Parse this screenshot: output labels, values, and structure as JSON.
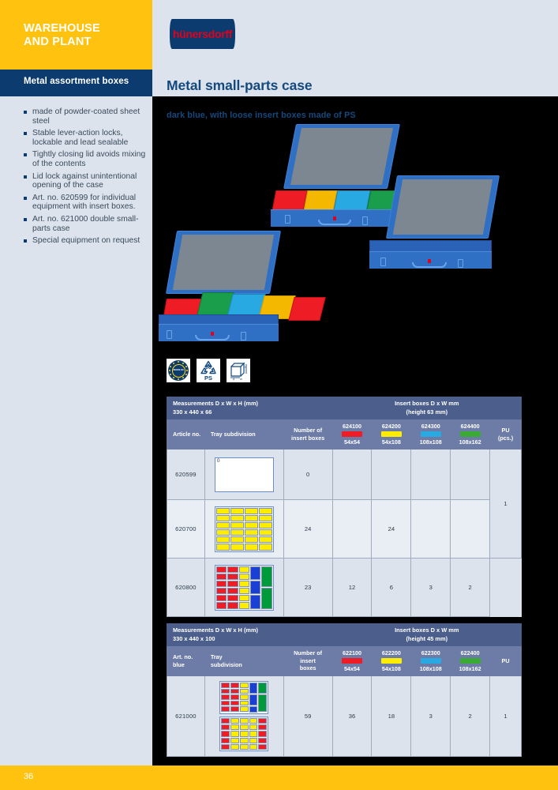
{
  "sidebar": {
    "category": "WAREHOUSE\nAND PLANT",
    "subcategory": "Metal assortment boxes",
    "features": [
      "made of powder-coated sheet steel",
      "Stable lever-action locks, lockable and lead sealable",
      "Tightly closing lid avoids mixing of the contents",
      "Lid lock against unintentional opening of the case",
      "Art. no. 620599 for individual equipment with insert boxes.",
      "Art. no. 621000 double small-parts case",
      "Special equipment on request"
    ]
  },
  "brand": {
    "logo_text": "hünersdorff"
  },
  "header": {
    "title": "Metal small-parts case",
    "subtitle": "dark blue, with loose insert boxes made of PS"
  },
  "certifications": [
    {
      "name": "made-in-europe",
      "line1": "MADE IN",
      "line2": "EUROPE"
    },
    {
      "name": "recycling-ps",
      "number": "06",
      "material": "PS"
    },
    {
      "name": "dimensions-cube",
      "d": "d",
      "w": "w",
      "h": "h"
    }
  ],
  "footer": {
    "page_number": "36"
  },
  "chart_data": {
    "type": "table",
    "title": "Metal small-parts case specifications",
    "tables": [
      {
        "id": "table-66",
        "measurements_label": "Measurements D x W x H (mm)",
        "measurements_value": "330 x 440 x 66",
        "insert_label": "Insert boxes D x W mm",
        "insert_height": "(height 63 mm)",
        "columns": [
          {
            "key": "art",
            "label": "Article\nno."
          },
          {
            "key": "tray",
            "label": "Tray subdivision"
          },
          {
            "key": "count",
            "label": "Number of\ninsert boxes"
          },
          {
            "key": "c1",
            "label": "624100",
            "size": "54x54",
            "color": "#ee1c25"
          },
          {
            "key": "c2",
            "label": "624200",
            "size": "54x108",
            "color": "#ffed00"
          },
          {
            "key": "c3",
            "label": "624300",
            "size": "108x108",
            "color": "#29a9e1"
          },
          {
            "key": "c4",
            "label": "624400",
            "size": "108x162",
            "color": "#3aaa35"
          },
          {
            "key": "pu",
            "label": "PU\n(pcs.)"
          }
        ],
        "rows": [
          {
            "art": "620599",
            "count": "0",
            "c1": "",
            "c2": "",
            "c3": "",
            "c4": "",
            "pu": ""
          },
          {
            "art": "620700",
            "count": "24",
            "c1": "",
            "c2": "24",
            "c3": "",
            "c4": "",
            "pu": "1"
          },
          {
            "art": "620800",
            "count": "23",
            "c1": "12",
            "c2": "6",
            "c3": "3",
            "c4": "2",
            "pu": ""
          }
        ]
      },
      {
        "id": "table-100",
        "measurements_label": "Measurements D x W x H (mm)",
        "measurements_value": "330 x 440 x 100",
        "insert_label": "Insert boxes D x W mm",
        "insert_height": "(height 45 mm)",
        "columns": [
          {
            "key": "art",
            "label": "Art. no.\nblue"
          },
          {
            "key": "tray",
            "label": "Tray\nsubdivision"
          },
          {
            "key": "count",
            "label": "Number of\ninsert\nboxes"
          },
          {
            "key": "c1",
            "label": "622100",
            "size": "54x54",
            "color": "#ee1c25"
          },
          {
            "key": "c2",
            "label": "622200",
            "size": "54x108",
            "color": "#ffed00"
          },
          {
            "key": "c3",
            "label": "622300",
            "size": "108x108",
            "color": "#29a9e1"
          },
          {
            "key": "c4",
            "label": "622400",
            "size": "108x162",
            "color": "#3aaa35"
          },
          {
            "key": "pu",
            "label": "PU"
          }
        ],
        "rows": [
          {
            "art": "621000",
            "count": "59",
            "c1": "36",
            "c2": "18",
            "c3": "3",
            "c4": "2",
            "pu": "1"
          }
        ]
      }
    ]
  },
  "colors": {
    "brand_yellow": "#ffc20e",
    "brand_navy": "#0b3b6f",
    "title_blue": "#14497e",
    "page_bg": "#dce3ec",
    "table_header_dark": "#4c5f8c",
    "table_header_light": "#6d7ca6"
  }
}
